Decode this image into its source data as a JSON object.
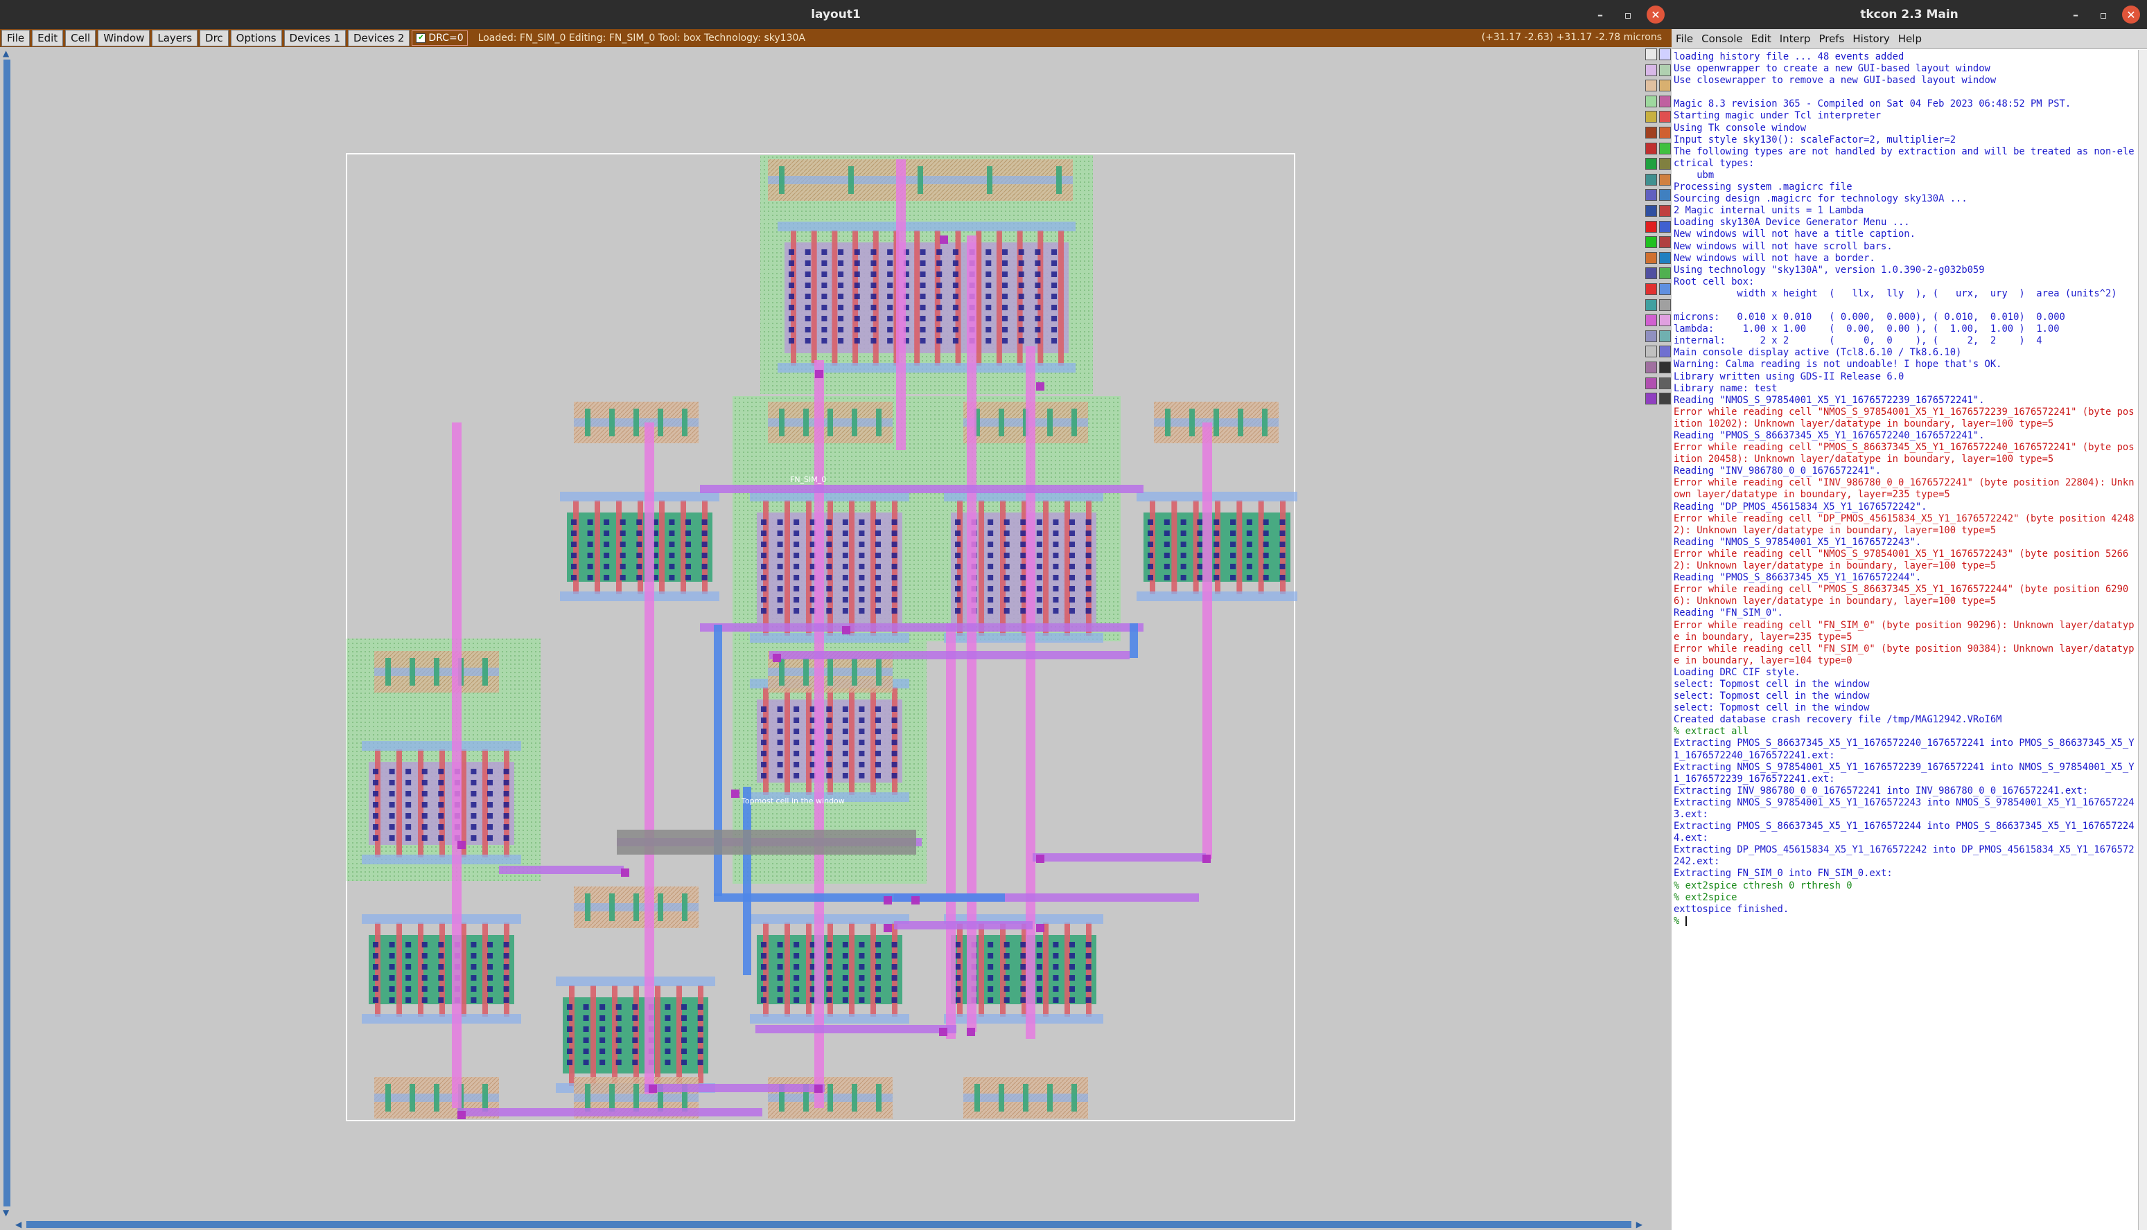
{
  "layout_window": {
    "title": "layout1",
    "menus": [
      "File",
      "Edit",
      "Cell",
      "Window",
      "Layers",
      "Drc",
      "Options",
      "Devices 1",
      "Devices 2"
    ],
    "drc_label": "DRC=0",
    "status": "Loaded: FN_SIM_0 Editing: FN_SIM_0 Tool: box  Technology: sky130A",
    "coords": "(+31.17 -2.63) +31.17 -2.78 microns",
    "canvas_labels": {
      "cell_label": "FN_SIM_0",
      "select_msg": "Topmost cell in the window"
    }
  },
  "console_window": {
    "title": "tkcon 2.3 Main",
    "menus": [
      "File",
      "Console",
      "Edit",
      "Interp",
      "Prefs",
      "History",
      "Help"
    ],
    "lines": [
      {
        "t": "loading history file ... 48 events added",
        "k": "n"
      },
      {
        "t": "Use openwrapper to create a new GUI-based layout window",
        "k": "n"
      },
      {
        "t": "Use closewrapper to remove a new GUI-based layout window",
        "k": "n"
      },
      {
        "t": "",
        "k": "n"
      },
      {
        "t": "Magic 8.3 revision 365 - Compiled on Sat 04 Feb 2023 06:48:52 PM PST.",
        "k": "n"
      },
      {
        "t": "Starting magic under Tcl interpreter",
        "k": "n"
      },
      {
        "t": "Using Tk console window",
        "k": "n"
      },
      {
        "t": "Input style sky130(): scaleFactor=2, multiplier=2",
        "k": "n"
      },
      {
        "t": "The following types are not handled by extraction and will be treated as non-electrical types:",
        "k": "n"
      },
      {
        "t": "    ubm",
        "k": "n"
      },
      {
        "t": "Processing system .magicrc file",
        "k": "n"
      },
      {
        "t": "Sourcing design .magicrc for technology sky130A ...",
        "k": "n"
      },
      {
        "t": "2 Magic internal units = 1 Lambda",
        "k": "n"
      },
      {
        "t": "Loading sky130A Device Generator Menu ...",
        "k": "n"
      },
      {
        "t": "New windows will not have a title caption.",
        "k": "n"
      },
      {
        "t": "New windows will not have scroll bars.",
        "k": "n"
      },
      {
        "t": "New windows will not have a border.",
        "k": "n"
      },
      {
        "t": "Using technology \"sky130A\", version 1.0.390-2-g032b059",
        "k": "n"
      },
      {
        "t": "Root cell box:",
        "k": "n"
      },
      {
        "t": "           width x height  (   llx,  lly  ), (   urx,  ury  )  area (units^2)",
        "k": "n"
      },
      {
        "t": "",
        "k": "n"
      },
      {
        "t": "microns:   0.010 x 0.010   ( 0.000,  0.000), ( 0.010,  0.010)  0.000",
        "k": "n"
      },
      {
        "t": "lambda:     1.00 x 1.00    (  0.00,  0.00 ), (  1.00,  1.00 )  1.00",
        "k": "n"
      },
      {
        "t": "internal:      2 x 2       (     0,  0    ), (     2,  2    )  4",
        "k": "n"
      },
      {
        "t": "Main console display active (Tcl8.6.10 / Tk8.6.10)",
        "k": "n"
      },
      {
        "t": "Warning: Calma reading is not undoable! I hope that's OK.",
        "k": "n"
      },
      {
        "t": "Library written using GDS-II Release 6.0",
        "k": "n"
      },
      {
        "t": "Library name: test",
        "k": "n"
      },
      {
        "t": "Reading \"NMOS_S_97854001_X5_Y1_1676572239_1676572241\".",
        "k": "n"
      },
      {
        "t": "Error while reading cell \"NMOS_S_97854001_X5_Y1_1676572239_1676572241\" (byte position 10202): Unknown layer/datatype in boundary, layer=100 type=5",
        "k": "e"
      },
      {
        "t": "Reading \"PMOS_S_86637345_X5_Y1_1676572240_1676572241\".",
        "k": "n"
      },
      {
        "t": "Error while reading cell \"PMOS_S_86637345_X5_Y1_1676572240_1676572241\" (byte position 20458): Unknown layer/datatype in boundary, layer=100 type=5",
        "k": "e"
      },
      {
        "t": "Reading \"INV_986780_0_0_1676572241\".",
        "k": "n"
      },
      {
        "t": "Error while reading cell \"INV_986780_0_0_1676572241\" (byte position 22804): Unknown layer/datatype in boundary, layer=235 type=5",
        "k": "e"
      },
      {
        "t": "Reading \"DP_PMOS_45615834_X5_Y1_1676572242\".",
        "k": "n"
      },
      {
        "t": "Error while reading cell \"DP_PMOS_45615834_X5_Y1_1676572242\" (byte position 42482): Unknown layer/datatype in boundary, layer=100 type=5",
        "k": "e"
      },
      {
        "t": "Reading \"NMOS_S_97854001_X5_Y1_1676572243\".",
        "k": "n"
      },
      {
        "t": "Error while reading cell \"NMOS_S_97854001_X5_Y1_1676572243\" (byte position 52662): Unknown layer/datatype in boundary, layer=100 type=5",
        "k": "e"
      },
      {
        "t": "Reading \"PMOS_S_86637345_X5_Y1_1676572244\".",
        "k": "n"
      },
      {
        "t": "Error while reading cell \"PMOS_S_86637345_X5_Y1_1676572244\" (byte position 62906): Unknown layer/datatype in boundary, layer=100 type=5",
        "k": "e"
      },
      {
        "t": "Reading \"FN_SIM_0\".",
        "k": "n"
      },
      {
        "t": "Error while reading cell \"FN_SIM_0\" (byte position 90296): Unknown layer/datatype in boundary, layer=235 type=5",
        "k": "e"
      },
      {
        "t": "Error while reading cell \"FN_SIM_0\" (byte position 90384): Unknown layer/datatype in boundary, layer=104 type=0",
        "k": "e"
      },
      {
        "t": "Loading DRC CIF style.",
        "k": "n"
      },
      {
        "t": "select: Topmost cell in the window",
        "k": "n"
      },
      {
        "t": "select: Topmost cell in the window",
        "k": "n"
      },
      {
        "t": "select: Topmost cell in the window",
        "k": "n"
      },
      {
        "t": "Created database crash recovery file /tmp/MAG12942.VRoI6M",
        "k": "n"
      },
      {
        "t": "% extract all",
        "k": "p"
      },
      {
        "t": "Extracting PMOS_S_86637345_X5_Y1_1676572240_1676572241 into PMOS_S_86637345_X5_Y1_1676572240_1676572241.ext:",
        "k": "n"
      },
      {
        "t": "Extracting NMOS_S_97854001_X5_Y1_1676572239_1676572241 into NMOS_S_97854001_X5_Y1_1676572239_1676572241.ext:",
        "k": "n"
      },
      {
        "t": "Extracting INV_986780_0_0_1676572241 into INV_986780_0_0_1676572241.ext:",
        "k": "n"
      },
      {
        "t": "Extracting NMOS_S_97854001_X5_Y1_1676572243 into NMOS_S_97854001_X5_Y1_1676572243.ext:",
        "k": "n"
      },
      {
        "t": "Extracting PMOS_S_86637345_X5_Y1_1676572244 into PMOS_S_86637345_X5_Y1_1676572244.ext:",
        "k": "n"
      },
      {
        "t": "Extracting DP_PMOS_45615834_X5_Y1_1676572242 into DP_PMOS_45615834_X5_Y1_1676572242.ext:",
        "k": "n"
      },
      {
        "t": "Extracting FN_SIM_0 into FN_SIM_0.ext:",
        "k": "n"
      },
      {
        "t": "% ext2spice cthresh 0 rthresh 0",
        "k": "p"
      },
      {
        "t": "% ext2spice",
        "k": "p"
      },
      {
        "t": "exttospice finished.",
        "k": "n"
      },
      {
        "t": "%",
        "k": "p"
      }
    ]
  },
  "colors": {
    "title_bg": "#2d2d2d",
    "magic_menubar": "#8a4a10",
    "canvas_bg": "#c8c8c8",
    "scrollbar": "#4a7fc0",
    "console_text": "#1a1acc",
    "console_error": "#cc1a1a",
    "nwell": "#9ed89e",
    "poly": "#d8606a",
    "diff_n": "#3aa67a",
    "diff_p": "#b5a3d0",
    "metal1": "#8fb2ea",
    "metal2": "#e57be0",
    "metal3": "#b870e8",
    "metal4": "#4f86e8",
    "contact": "#1e1e8c"
  },
  "icons": [
    "minimize-icon",
    "maximize-icon",
    "close-icon",
    "checkbox-icon",
    "arrow-up-icon",
    "arrow-down-icon",
    "arrow-left-icon",
    "arrow-right-icon"
  ]
}
